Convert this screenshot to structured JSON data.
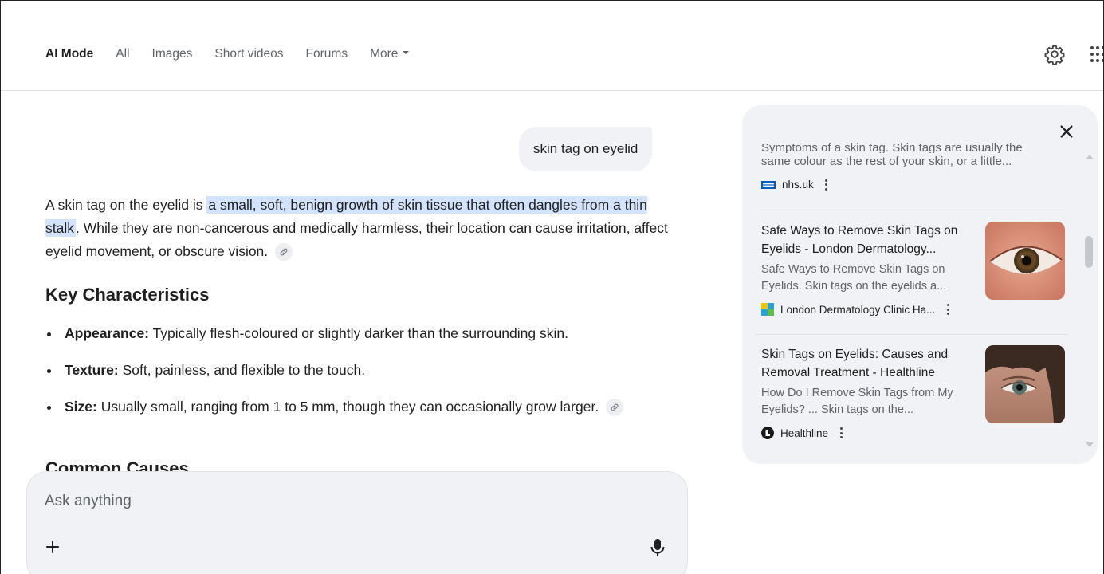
{
  "nav": {
    "tabs": [
      {
        "label": "AI Mode",
        "active": true
      },
      {
        "label": "All"
      },
      {
        "label": "Images"
      },
      {
        "label": "Short videos"
      },
      {
        "label": "Forums"
      },
      {
        "label": "More"
      }
    ]
  },
  "query": "skin tag on eyelid",
  "answer": {
    "intro_pre": "A skin tag on the eyelid is ",
    "intro_highlight": "a small, soft, benign growth of skin tissue that often dangles from a thin stalk",
    "intro_post": ". While they are non-cancerous and medically harmless, their location can cause irritation, affect eyelid movement, or obscure vision.",
    "heading": "Key Characteristics",
    "bullets": [
      {
        "term": "Appearance:",
        "text": " Typically flesh-coloured or slightly darker than the surrounding skin."
      },
      {
        "term": "Texture:",
        "text": " Soft, painless, and flexible to the touch."
      },
      {
        "term": "Size:",
        "text": " Usually small, ranging from 1 to 5 mm, though they can occasionally grow larger."
      }
    ],
    "next_heading": "Common Causes"
  },
  "ask": {
    "placeholder": "Ask anything"
  },
  "panel": {
    "cards": [
      {
        "clipped": "Symptoms of a skin tag. Skin tags are usually the",
        "snippet": "same colour as the rest of your skin, or a little...",
        "source": "nhs.uk"
      },
      {
        "title": "Safe Ways to Remove Skin Tags on Eyelids - London Dermatology...",
        "snippet": "Safe Ways to Remove Skin Tags on Eyelids. Skin tags on the eyelids a...",
        "source": "London Dermatology Clinic Ha..."
      },
      {
        "title": "Skin Tags on Eyelids: Causes and Removal Treatment - Healthline",
        "snippet": "How Do I Remove Skin Tags from My Eyelids? ... Skin tags on the...",
        "source": "Healthline"
      }
    ]
  },
  "colors": {
    "highlight": "#d3e3fd",
    "panel_bg": "#f0f2f5",
    "text": "#1f1f1f",
    "muted": "#5f6368"
  }
}
